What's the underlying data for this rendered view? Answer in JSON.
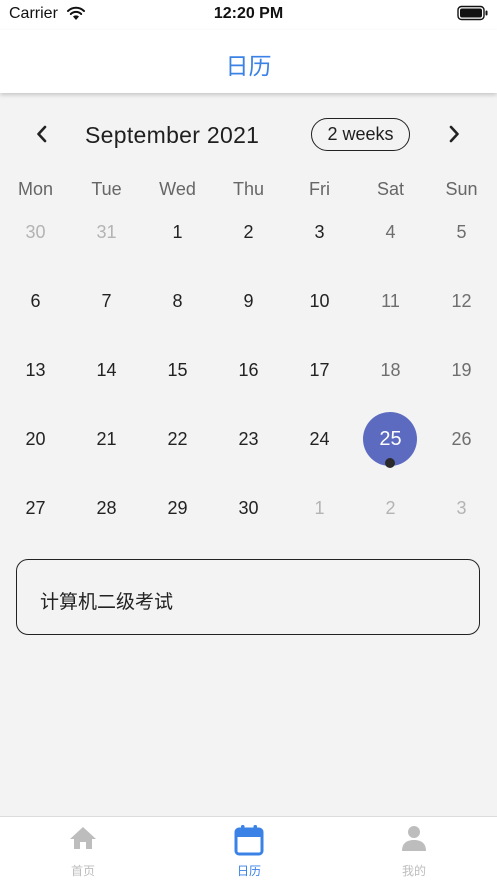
{
  "status_bar": {
    "carrier": "Carrier",
    "time": "12:20 PM"
  },
  "nav": {
    "title": "日历"
  },
  "calendar": {
    "month_label": "September 2021",
    "format_button": "2 weeks",
    "weekdays": [
      "Mon",
      "Tue",
      "Wed",
      "Thu",
      "Fri",
      "Sat",
      "Sun"
    ],
    "weeks": [
      [
        "30",
        "31",
        "1",
        "2",
        "3",
        "4",
        "5"
      ],
      [
        "6",
        "7",
        "8",
        "9",
        "10",
        "11",
        "12"
      ],
      [
        "13",
        "14",
        "15",
        "16",
        "17",
        "18",
        "19"
      ],
      [
        "20",
        "21",
        "22",
        "23",
        "24",
        "25",
        "26"
      ],
      [
        "27",
        "28",
        "29",
        "30",
        "1",
        "2",
        "3"
      ]
    ],
    "selected_day": "25"
  },
  "events": [
    {
      "title": "计算机二级考试"
    }
  ],
  "tabs": [
    {
      "label": "首页",
      "icon": "home-icon",
      "active": false
    },
    {
      "label": "日历",
      "icon": "calendar-icon",
      "active": true
    },
    {
      "label": "我的",
      "icon": "person-icon",
      "active": false
    }
  ],
  "colors": {
    "accent": "#3b82e6",
    "selected": "#5c6bc0",
    "inactive_tab": "#bdbdbd"
  }
}
